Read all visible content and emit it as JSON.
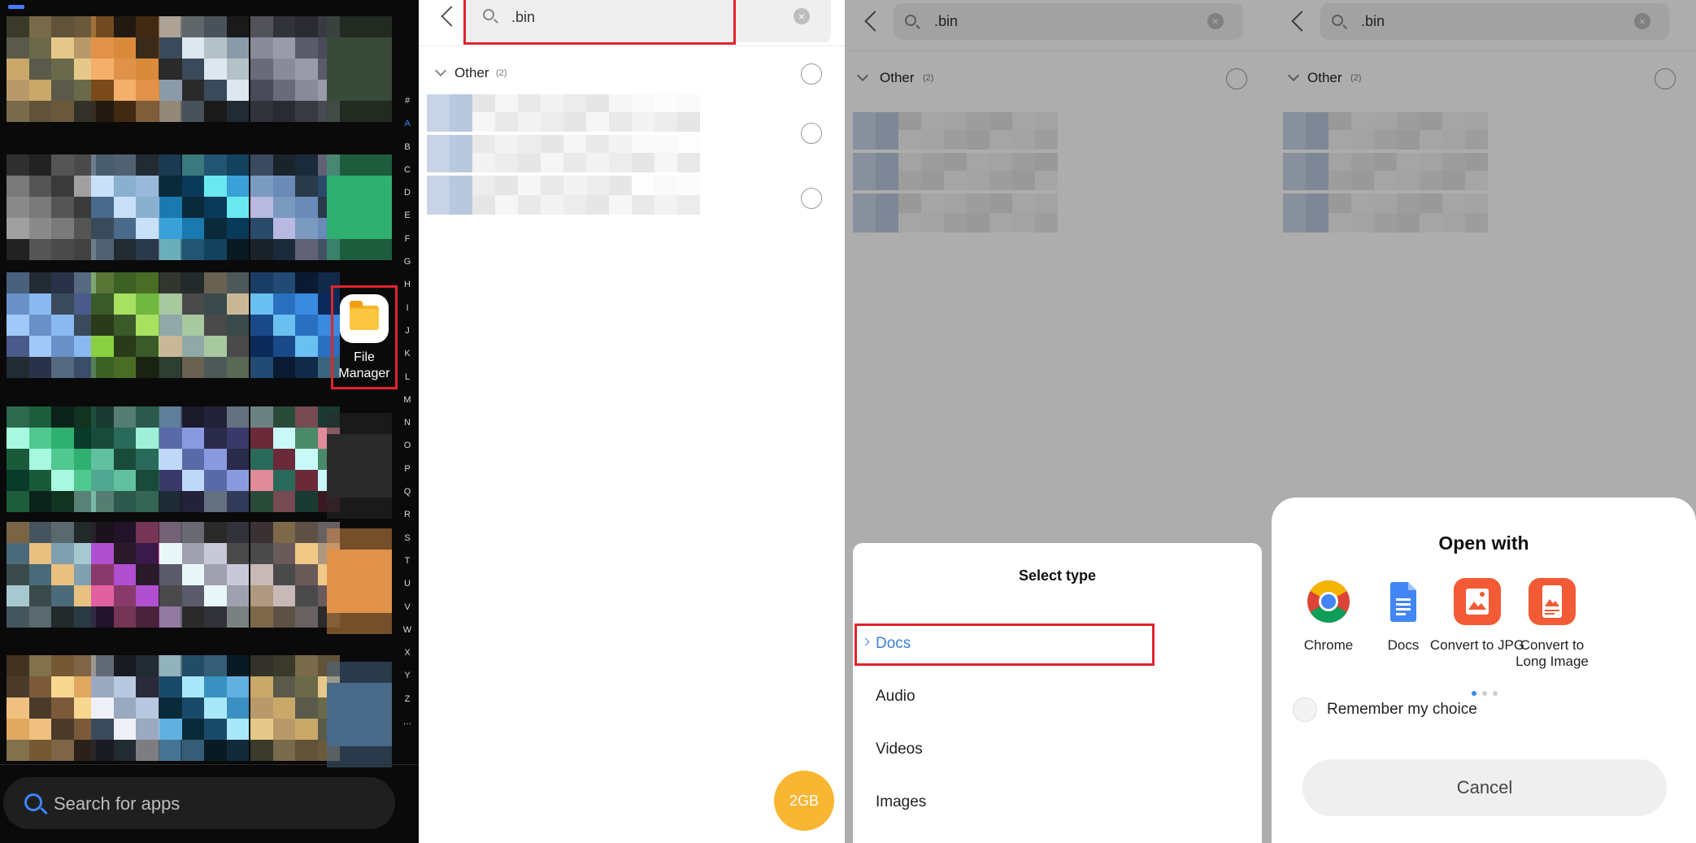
{
  "launcher": {
    "file_manager_label": "File Manager",
    "alphabet": [
      "#",
      "A",
      "B",
      "C",
      "D",
      "E",
      "F",
      "G",
      "H",
      "I",
      "J",
      "K",
      "L",
      "M",
      "N",
      "O",
      "P",
      "Q",
      "R",
      "S",
      "T",
      "U",
      "V",
      "W",
      "X",
      "Y",
      "Z",
      "…"
    ],
    "search_placeholder": "Search for apps",
    "accent_color": "#3d86ff"
  },
  "search_panel": {
    "query": ".bin",
    "group_name": "Other",
    "group_count": "(2)",
    "storage_badge": "2GB"
  },
  "select_type_panel": {
    "query": ".bin",
    "group_name": "Other",
    "group_count": "(2)",
    "sheet_title": "Select type",
    "options": [
      "Docs",
      "Audio",
      "Videos",
      "Images"
    ],
    "selected_option": "Docs"
  },
  "open_with_panel": {
    "query": ".bin",
    "group_name": "Other",
    "group_count": "(2)",
    "sheet_title": "Open with",
    "apps": [
      {
        "label": "Chrome",
        "icon": "chrome-icon"
      },
      {
        "label": "Docs",
        "icon": "google-docs-icon"
      },
      {
        "label": "Convert to JPG",
        "icon": "image-convert-icon"
      },
      {
        "label": "Convert to Long Image",
        "icon": "long-image-icon"
      }
    ],
    "remember_label": "Remember my choice",
    "cancel_label": "Cancel"
  },
  "colors": {
    "highlight_red": "#e0242c",
    "fab_orange": "#f8b632",
    "selected_blue": "#3a7fd6"
  }
}
